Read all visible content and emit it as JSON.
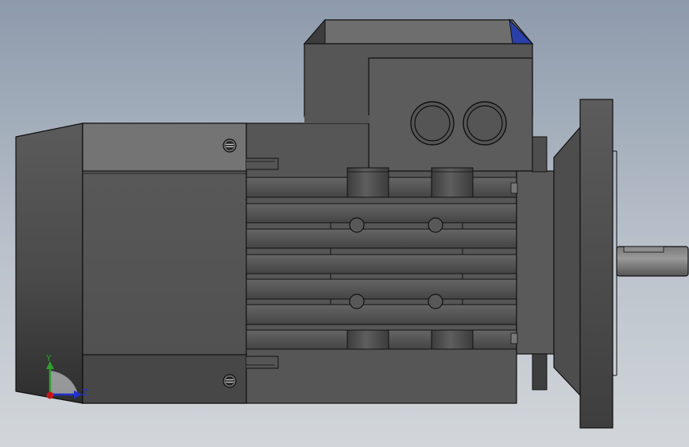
{
  "view": {
    "background_top": "#8d9aab",
    "background_bottom": "#d2d6da"
  },
  "triad": {
    "y_label": "Y",
    "z_label": "Z",
    "y_color": "#2e9e2e",
    "z_color": "#2230d0",
    "x_color": "#c01818"
  },
  "model": {
    "body_color": "#575757",
    "edge_color": "#111111",
    "accent_color": "#2a3fa8"
  }
}
